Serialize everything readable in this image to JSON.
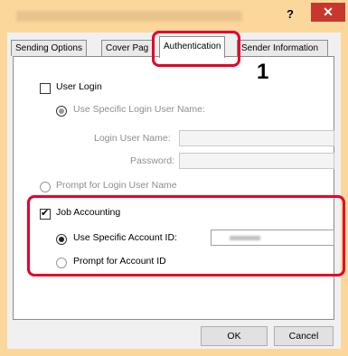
{
  "window": {
    "help_label": "?",
    "close_label": "✕"
  },
  "tabs": [
    {
      "label": "Sending Options",
      "selected": false
    },
    {
      "label": "Cover Pag",
      "selected": false
    },
    {
      "label": "Authentication",
      "selected": true
    },
    {
      "label": "Sender Information",
      "selected": false
    }
  ],
  "user_login": {
    "label": "User Login",
    "checked": false,
    "use_specific_label": "Use Specific Login User Name:",
    "login_user_name_label": "Login User Name:",
    "password_label": "Password:",
    "prompt_label": "Prompt for Login User Name"
  },
  "job_accounting": {
    "label": "Job Accounting",
    "checked": true,
    "use_specific_label": "Use Specific Account ID:",
    "prompt_label": "Prompt for Account ID"
  },
  "buttons": {
    "ok": "OK",
    "cancel": "Cancel"
  },
  "callout": {
    "number": "1"
  },
  "colors": {
    "highlight": "#e4002b",
    "titlebar": "#fbd79c",
    "close": "#c8372e"
  }
}
